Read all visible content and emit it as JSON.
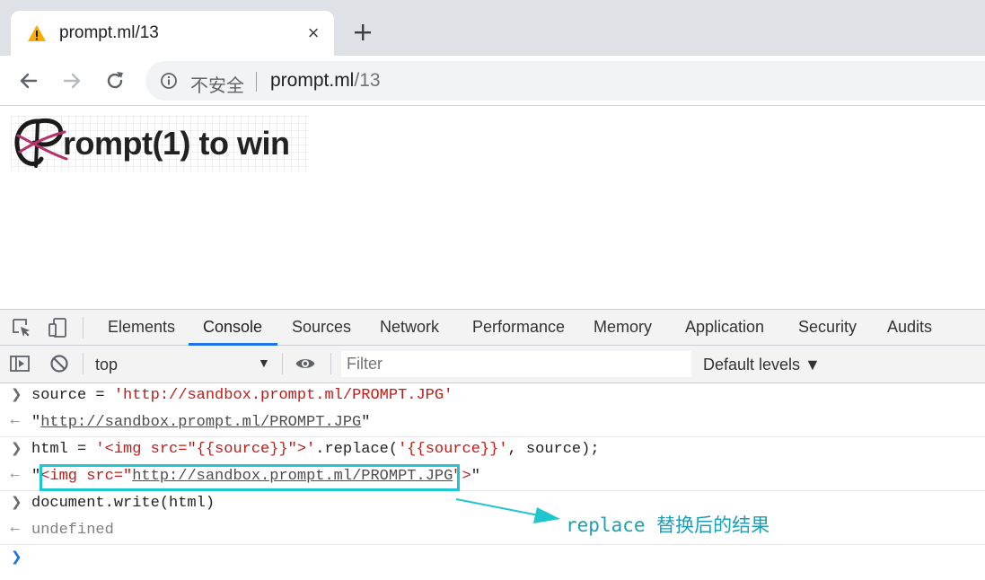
{
  "tab": {
    "title": "prompt.ml/13",
    "close": "×"
  },
  "omnibox": {
    "security_label": "不安全",
    "url_host": "prompt.ml",
    "url_path": "/13"
  },
  "page": {
    "logo_text": "rompt(1) to win"
  },
  "devtools": {
    "tabs": [
      "Elements",
      "Console",
      "Sources",
      "Network",
      "Performance",
      "Memory",
      "Application",
      "Security",
      "Audits"
    ],
    "active_tab": "Console",
    "context": "top",
    "filter_placeholder": "Filter",
    "levels": "Default levels ▼"
  },
  "console": {
    "line1": {
      "code": "source = ",
      "str": "'http://sandbox.prompt.ml/PROMPT.JPG'"
    },
    "line2": {
      "open": "\"",
      "url": "http://sandbox.prompt.ml/PROMPT.JPG",
      "close": "\""
    },
    "line3": {
      "code1": "html = ",
      "str1": "'<img src=\"{{source}}\">'",
      "code2": ".replace(",
      "str2": "'{{source}}'",
      "code3": ", source);"
    },
    "line4": {
      "open": "\"",
      "tag_open": "<img src=\"",
      "url": "http://sandbox.prompt.ml/PROMPT.JPG",
      "tag_close": "\">",
      "close": "\""
    },
    "line5": {
      "code": "document.write(html)"
    },
    "line6": {
      "result": "undefined"
    }
  },
  "annotation": {
    "text": "replace 替换后的结果",
    "color": "#1fc5cf"
  }
}
